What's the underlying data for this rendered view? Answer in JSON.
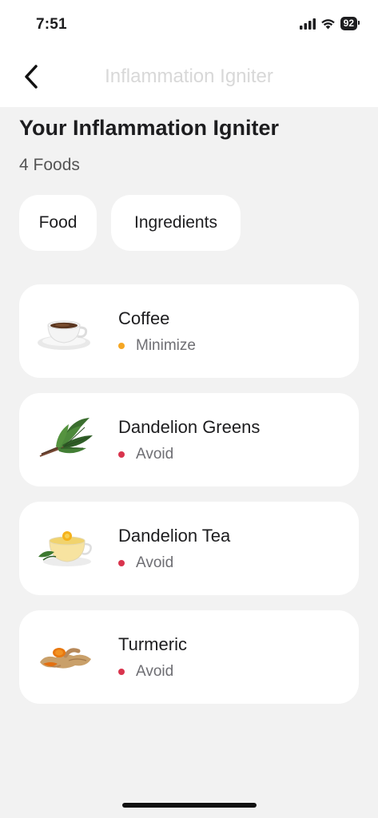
{
  "status_bar": {
    "time": "7:51",
    "battery": "92"
  },
  "nav": {
    "title": "Inflammation Igniter"
  },
  "header": {
    "title": "Your Inflammation Igniter",
    "count": "4 Foods"
  },
  "tabs": [
    {
      "label": "Food"
    },
    {
      "label": "Ingredients"
    }
  ],
  "foods": [
    {
      "name": "Coffee",
      "status": "Minimize",
      "status_color": "#f5a623",
      "icon": "coffee-cup"
    },
    {
      "name": "Dandelion Greens",
      "status": "Avoid",
      "status_color": "#d9344d",
      "icon": "dandelion-greens"
    },
    {
      "name": "Dandelion Tea",
      "status": "Avoid",
      "status_color": "#d9344d",
      "icon": "tea-cup"
    },
    {
      "name": "Turmeric",
      "status": "Avoid",
      "status_color": "#d9344d",
      "icon": "turmeric-root"
    }
  ]
}
